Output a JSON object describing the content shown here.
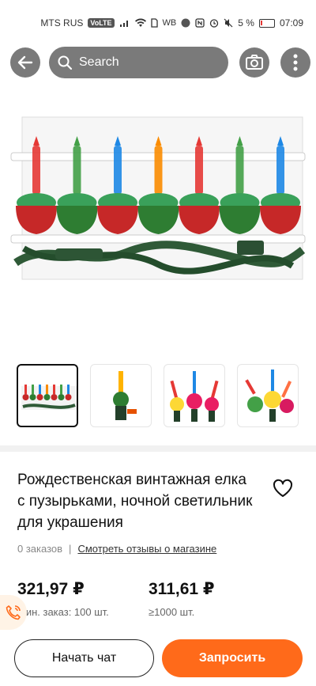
{
  "status": {
    "carrier": "MTS RUS",
    "carrier_badge": "VoLTE",
    "wb": "WB",
    "battery": "5 %",
    "time": "07:09"
  },
  "search": {
    "placeholder": "Search"
  },
  "icons": {
    "back": "arrow-left-icon",
    "search": "search-icon",
    "camera": "camera-icon",
    "more": "more-vertical-icon",
    "favorite": "heart-icon",
    "chat": "phone-chat-icon"
  },
  "thumbnails": [
    {
      "label": "thumbnail-1",
      "selected": true
    },
    {
      "label": "thumbnail-2",
      "selected": false
    },
    {
      "label": "thumbnail-3",
      "selected": false
    },
    {
      "label": "thumbnail-4",
      "selected": false
    }
  ],
  "product": {
    "title": "Рождественская винтажная елка с пузырьками, ночной светильник для украшения",
    "orders": "0 заказов",
    "separator": "|",
    "reviews_link": "Смотреть отзывы о магазине"
  },
  "prices": [
    {
      "price": "321,97 ₽",
      "note": "Мин. заказ: 100 шт."
    },
    {
      "price": "311,61 ₽",
      "note": "≥1000 шт."
    }
  ],
  "actions": {
    "chat": "Начать чат",
    "request": "Запросить"
  },
  "colors": {
    "accent": "#ff6a1a",
    "overlay_button": "#7a7a7a"
  }
}
